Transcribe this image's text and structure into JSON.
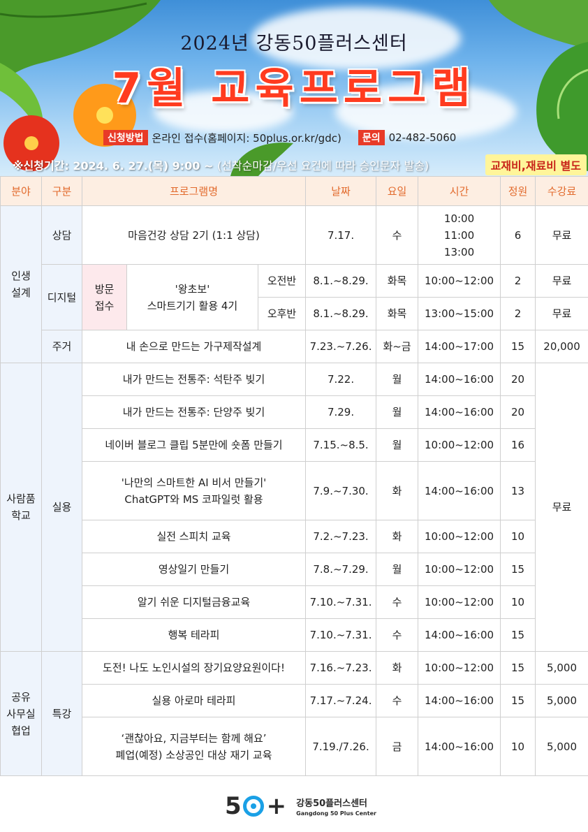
{
  "header": {
    "subtitle": "2024년 강동50플러스센터",
    "title": "7월 교육프로그램",
    "apply_method_label": "신청방법",
    "apply_method_value": "온라인 접수(홈페이지: 50plus.or.kr/gdc)",
    "inquiry_label": "문의",
    "inquiry_value": "02-482-5060",
    "period_label": "※신청기간: 2024. 6. 27.(목) 9:00 ~",
    "period_note": "(선착순마감/우선 요건에 따라 승인문자 발송)",
    "fee_notice": "교재비,재료비 별도"
  },
  "table": {
    "headers": [
      "분야",
      "구분",
      "프로그램명",
      "날짜",
      "요일",
      "시간",
      "정원",
      "수강료"
    ],
    "field_life": "인생\n설계",
    "field_school": "사람품\n학교",
    "field_share": "공유\n사무실\n협업",
    "sub_counsel": "상담",
    "sub_digital": "디지털",
    "sub_house": "주거",
    "sub_practical": "실용",
    "sub_special": "특강",
    "visit_label": "방문\n접수",
    "row1": {
      "name": "마음건강 상담 2기 (1:1 상담)",
      "date": "7.17.",
      "day": "수",
      "time": "10:00\n11:00\n13:00",
      "cap": "6",
      "fee": "무료"
    },
    "row2": {
      "name": "'왕초보'\n스마트기기 활용 4기",
      "session": "오전반",
      "date": "8.1.~8.29.",
      "day": "화목",
      "time": "10:00~12:00",
      "cap": "2",
      "fee": "무료"
    },
    "row3": {
      "session": "오후반",
      "date": "8.1.~8.29.",
      "day": "화목",
      "time": "13:00~15:00",
      "cap": "2",
      "fee": "무료"
    },
    "row4": {
      "name": "내 손으로 만드는 가구제작설계",
      "date": "7.23.~7.26.",
      "day": "화~금",
      "time": "14:00~17:00",
      "cap": "15",
      "fee": "20,000"
    },
    "row5": {
      "name": "내가 만드는 전통주: 석탄주 빚기",
      "date": "7.22.",
      "day": "월",
      "time": "14:00~16:00",
      "cap": "20"
    },
    "row6": {
      "name": "내가 만드는 전통주: 단양주 빚기",
      "date": "7.29.",
      "day": "월",
      "time": "14:00~16:00",
      "cap": "20"
    },
    "row7": {
      "name": "네이버 블로그 클립 5분만에 숏폼 만들기",
      "date": "7.15.~8.5.",
      "day": "월",
      "time": "10:00~12:00",
      "cap": "16"
    },
    "row8": {
      "name": "'나만의 스마트한 AI 비서 만들기'\nChatGPT와 MS 코파일럿 활용",
      "date": "7.9.~7.30.",
      "day": "화",
      "time": "14:00~16:00",
      "cap": "13"
    },
    "row9": {
      "name": "실전 스피치 교육",
      "date": "7.2.~7.23.",
      "day": "화",
      "time": "10:00~12:00",
      "cap": "10"
    },
    "row10": {
      "name": "영상일기 만들기",
      "date": "7.8.~7.29.",
      "day": "월",
      "time": "10:00~12:00",
      "cap": "15"
    },
    "row11": {
      "name": "알기 쉬운 디지털금융교육",
      "date": "7.10.~7.31.",
      "day": "수",
      "time": "10:00~12:00",
      "cap": "10"
    },
    "row12": {
      "name": "행복 테라피",
      "date": "7.10.~7.31.",
      "day": "수",
      "time": "14:00~16:00",
      "cap": "15"
    },
    "school_fee": "무료",
    "row13": {
      "name": "도전! 나도 노인시설의 장기요양요원이다!",
      "date": "7.16.~7.23.",
      "day": "화",
      "time": "10:00~12:00",
      "cap": "15",
      "fee": "5,000"
    },
    "row14": {
      "name": "실용 아로마 테라피",
      "date": "7.17.~7.24.",
      "day": "수",
      "time": "14:00~16:00",
      "cap": "15",
      "fee": "5,000"
    },
    "row15": {
      "name": "‘괜찮아요, 지금부터는 함께 해요’\n폐업(예정) 소상공인 대상 재기 교육",
      "date": "7.19./7.26.",
      "day": "금",
      "time": "14:00~16:00",
      "cap": "10",
      "fee": "5,000"
    }
  },
  "footer": {
    "logo_5": "5",
    "logo_plus": "+",
    "org_kr": "강동50플러스센터",
    "org_en": "Gangdong 50 Plus Center"
  },
  "colors": {
    "title_red": "#ff3b1f",
    "header_orange": "#e26a2c",
    "field_blue": "#eef4fc",
    "visit_pink": "#fde9ec",
    "logo_blue": "#1aa0e6",
    "fee_yellow": "#fff59a"
  }
}
